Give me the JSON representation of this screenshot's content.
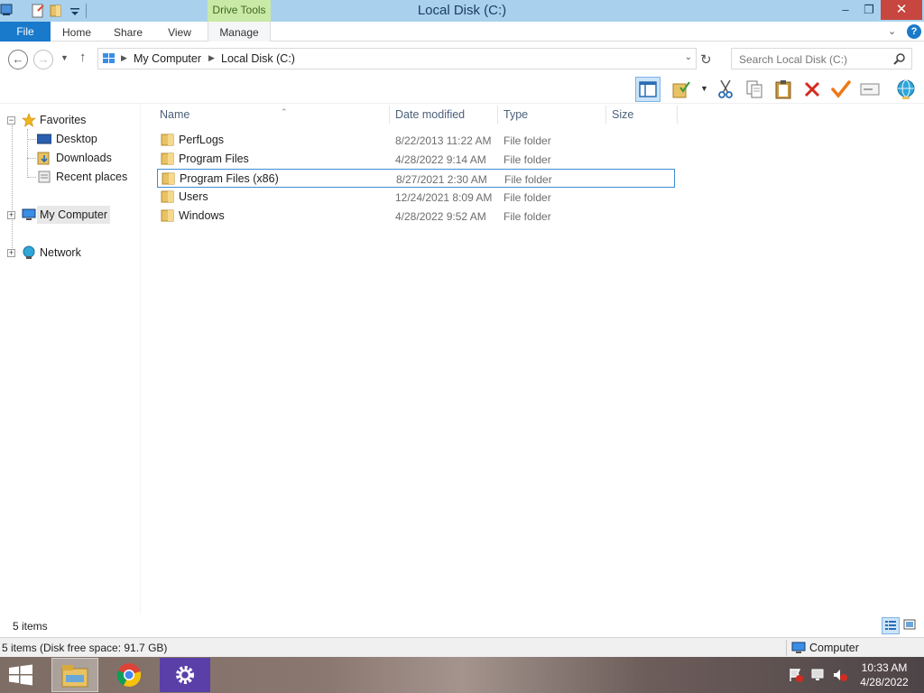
{
  "window": {
    "title": "Local Disk (C:)",
    "contextual_tab": "Drive Tools",
    "minimize": "–",
    "maximize": "❐",
    "close": "✕"
  },
  "ribbon": {
    "tabs": [
      {
        "label": "File"
      },
      {
        "label": "Home"
      },
      {
        "label": "Share"
      },
      {
        "label": "View"
      },
      {
        "label": "Manage"
      }
    ],
    "help": "?"
  },
  "address": {
    "breadcrumbs": [
      "My Computer",
      "Local Disk (C:)"
    ],
    "search_placeholder": "Search Local Disk (C:)"
  },
  "toolbar": {
    "icons": [
      "preview-pane-icon",
      "folder-options-icon",
      "cut-icon",
      "copy-icon",
      "paste-icon",
      "delete-icon",
      "checkmark-icon",
      "rename-icon",
      "network-globe-icon"
    ]
  },
  "navigation": {
    "favorites": {
      "label": "Favorites",
      "items": [
        {
          "label": "Desktop"
        },
        {
          "label": "Downloads"
        },
        {
          "label": "Recent places"
        }
      ]
    },
    "my_computer": "My Computer",
    "network": "Network"
  },
  "file_list": {
    "columns": [
      "Name",
      "Date modified",
      "Type",
      "Size"
    ],
    "rows": [
      {
        "name": "PerfLogs",
        "date": "8/22/2013 11:22 AM",
        "type": "File folder",
        "size": ""
      },
      {
        "name": "Program Files",
        "date": "4/28/2022 9:14 AM",
        "type": "File folder",
        "size": ""
      },
      {
        "name": "Program Files (x86)",
        "date": "8/27/2021 2:30 AM",
        "type": "File folder",
        "size": ""
      },
      {
        "name": "Users",
        "date": "12/24/2021 8:09 AM",
        "type": "File folder",
        "size": ""
      },
      {
        "name": "Windows",
        "date": "4/28/2022 9:52 AM",
        "type": "File folder",
        "size": ""
      }
    ],
    "selected_index": 2
  },
  "status": {
    "item_count": "5 items",
    "detail": "5 items (Disk free space: 91.7 GB)",
    "location": "Computer"
  },
  "taskbar": {
    "apps": [
      "file-explorer",
      "chrome",
      "settings"
    ],
    "time": "10:33 AM",
    "date": "4/28/2022"
  },
  "colors": {
    "title_bar": "#a9d1ee",
    "file_tab": "#1979ca",
    "drive_tools": "#c9e9a7",
    "close_button": "#c7463f",
    "selection_border": "#3d8bd8"
  }
}
